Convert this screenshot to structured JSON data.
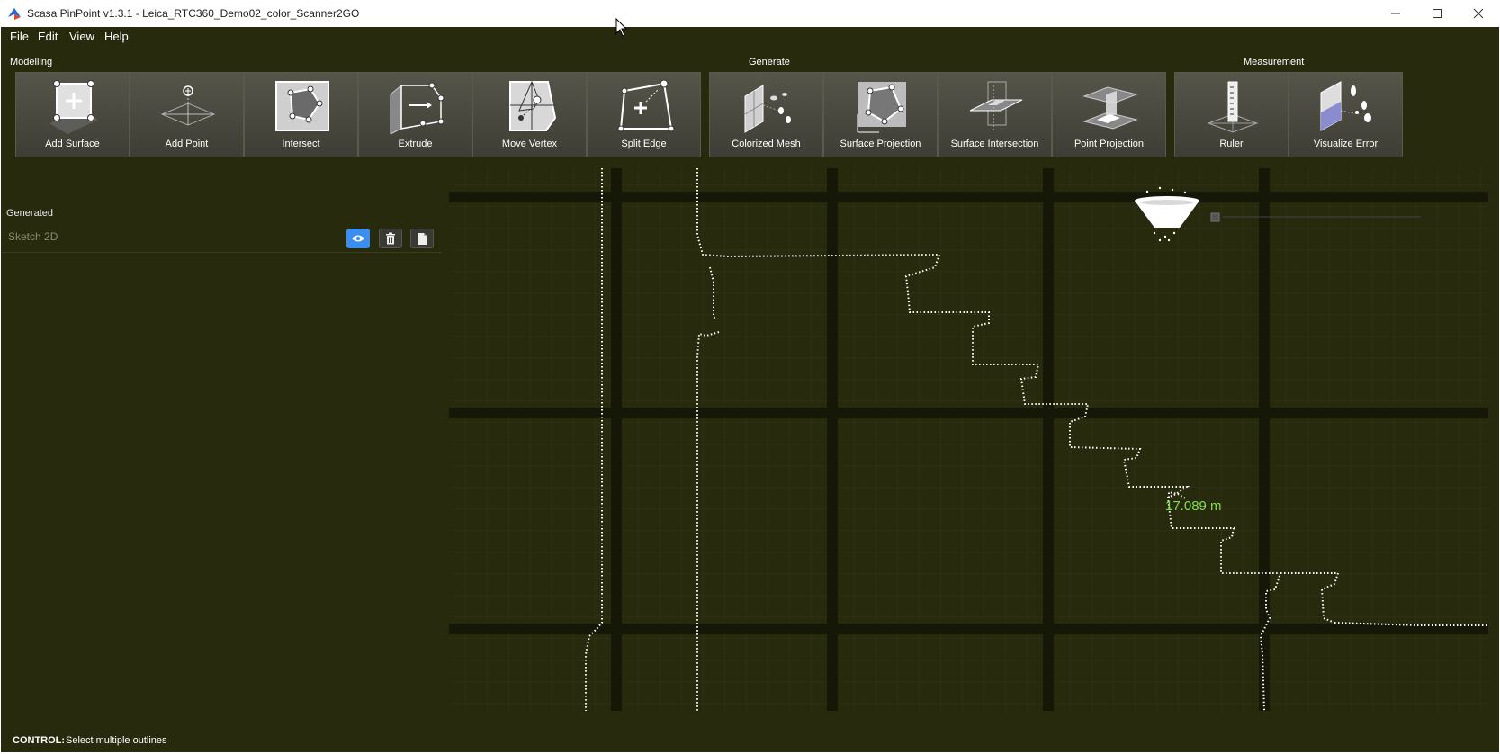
{
  "window": {
    "title": "Scasa PinPoint v1.3.1 - Leica_RTC360_Demo02_color_Scanner2GO",
    "minimize_icon": "minimize-icon",
    "maximize_icon": "maximize-icon",
    "close_icon": "close-icon"
  },
  "menu": [
    "File",
    "Edit",
    "View",
    "Help"
  ],
  "toolbar": {
    "groups": [
      "Modelling",
      "Generate",
      "Measurement"
    ],
    "tools": [
      {
        "label": "Add Surface",
        "icon": "add-surface-icon"
      },
      {
        "label": "Add Point",
        "icon": "add-point-icon"
      },
      {
        "label": "Intersect",
        "icon": "intersect-icon"
      },
      {
        "label": "Extrude",
        "icon": "extrude-icon"
      },
      {
        "label": "Move Vertex",
        "icon": "move-vertex-icon"
      },
      {
        "label": "Split Edge",
        "icon": "split-edge-icon"
      },
      {
        "label": "Colorized Mesh",
        "icon": "colorized-mesh-icon"
      },
      {
        "label": "Surface Projection",
        "icon": "surface-projection-icon"
      },
      {
        "label": "Surface Intersection",
        "icon": "surface-intersection-icon"
      },
      {
        "label": "Point Projection",
        "icon": "point-projection-icon"
      },
      {
        "label": "Ruler",
        "icon": "ruler-icon"
      },
      {
        "label": "Visualize Error",
        "icon": "visualize-error-icon"
      }
    ]
  },
  "panel": {
    "generated_label": "Generated",
    "items": [
      {
        "label": "Sketch 2D",
        "visible_icon": "eye-icon",
        "delete_icon": "trash-icon",
        "export_icon": "page-icon"
      }
    ]
  },
  "viewport": {
    "measurement_label": "17.089 m",
    "measurement_color": "#7fe04a",
    "background_color": "#272a0c"
  },
  "status": {
    "key": "CONTROL:",
    "text": "Select multiple outlines"
  }
}
